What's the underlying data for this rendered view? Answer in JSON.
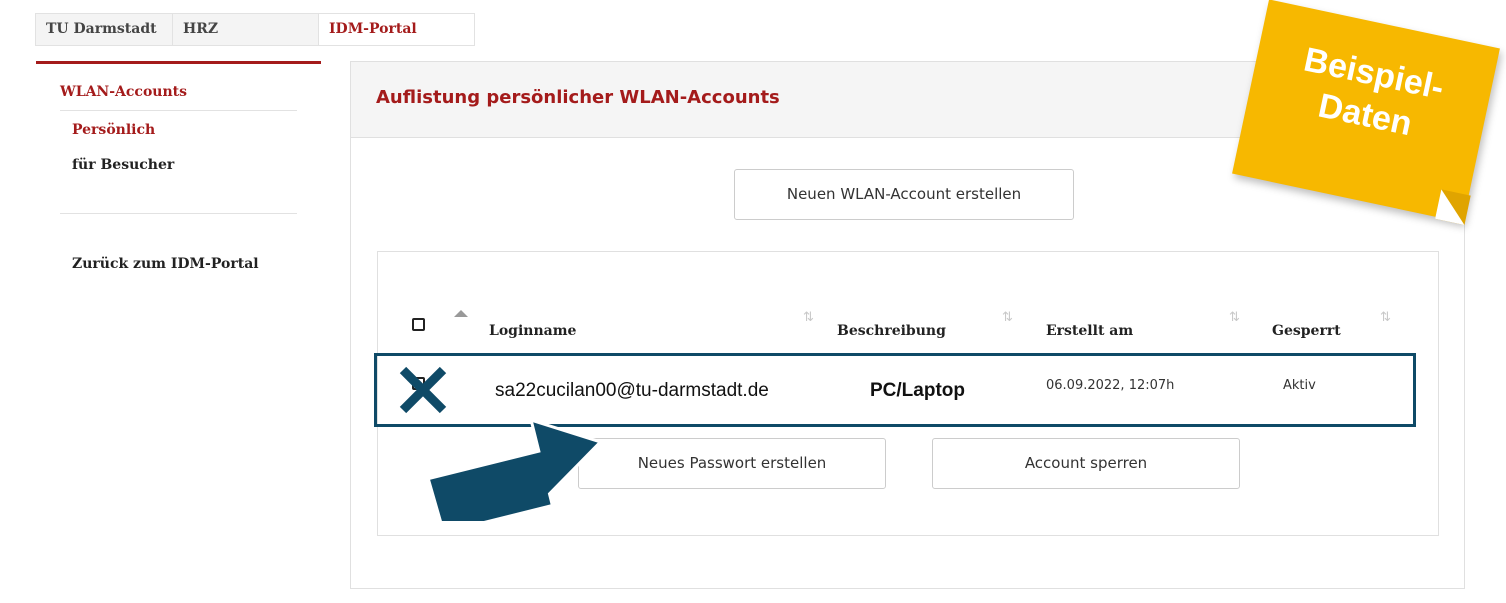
{
  "breadcrumb": {
    "items": [
      "TU Darmstadt",
      "HRZ",
      "IDM-Portal"
    ]
  },
  "sidebar": {
    "heading": "WLAN-Accounts",
    "items": [
      "Persönlich",
      "für Besucher"
    ],
    "back_link": "Zurück zum IDM-Portal"
  },
  "main": {
    "title": "Auflistung persönlicher WLAN-Accounts",
    "new_account_button": "Neuen WLAN-Account erstellen",
    "table": {
      "columns": [
        "Loginname",
        "Beschreibung",
        "Erstellt am",
        "Gesperrt"
      ],
      "rows": [
        {
          "login": "sa22cucilan00@tu-darmstadt.de",
          "description": "PC/Laptop",
          "created": "06.09.2022, 12:07h",
          "locked": "Aktiv"
        }
      ]
    },
    "new_password_button": "Neues Passwort erstellen",
    "lock_account_button": "Account sperren"
  },
  "overlay": {
    "sticky_note_lines": [
      "Beispiel-",
      "Daten"
    ],
    "note_color": "#f7b800",
    "annotation_color": "#0f4a67"
  },
  "colors": {
    "accent": "#a41b1b"
  }
}
